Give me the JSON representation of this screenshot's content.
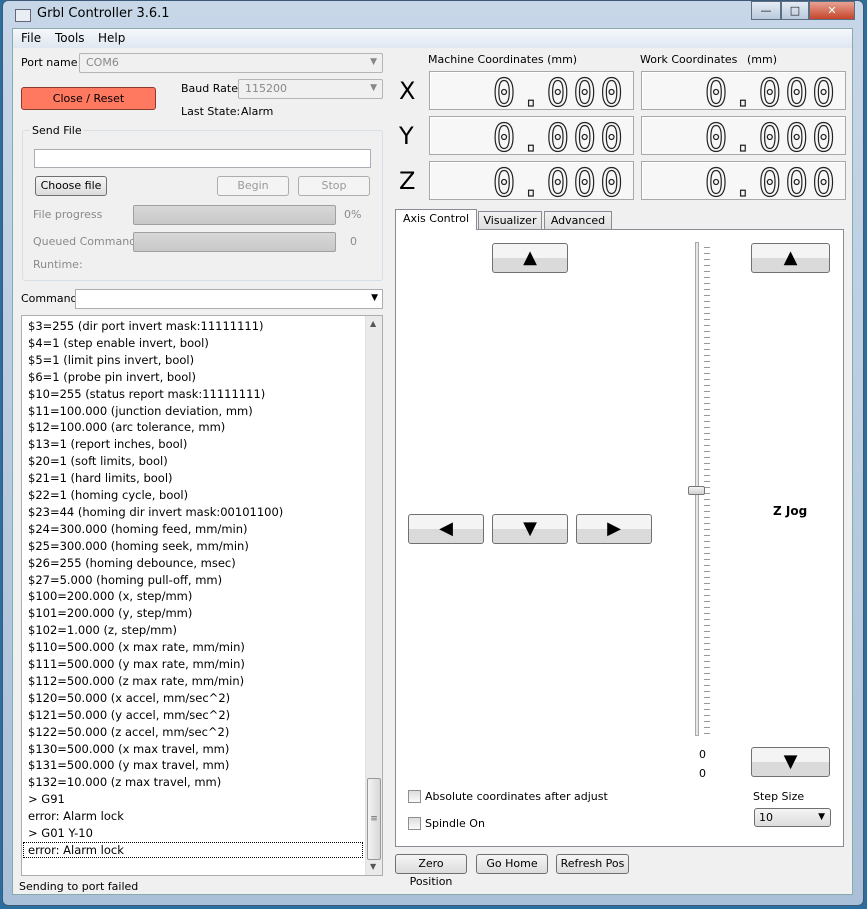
{
  "window": {
    "title": "Grbl Controller 3.6.1",
    "min": "—",
    "max": "□",
    "close": "✕"
  },
  "menu": [
    "File",
    "Tools",
    "Help"
  ],
  "port": {
    "label": "Port name",
    "value": "COM6"
  },
  "baud": {
    "label": "Baud Rate",
    "value": "115200"
  },
  "close_reset": "Close / Reset",
  "last_state": {
    "label": "Last State:",
    "value": "Alarm"
  },
  "send_file": {
    "title": "Send File",
    "file_value": "",
    "choose": "Choose file",
    "begin": "Begin",
    "stop": "Stop",
    "file_progress_label": "File progress",
    "file_progress_value": "0%",
    "file_progress_fraction": 0,
    "queued_label": "Queued Commands",
    "queued_value": "0",
    "runtime_label": "Runtime:"
  },
  "command": {
    "label": "Command",
    "value": ""
  },
  "console": [
    "$3=255 (dir port invert mask:11111111)",
    "$4=1 (step enable invert, bool)",
    "$5=1 (limit pins invert, bool)",
    "$6=1 (probe pin invert, bool)",
    "$10=255 (status report mask:11111111)",
    "$11=100.000 (junction deviation, mm)",
    "$12=100.000 (arc tolerance, mm)",
    "$13=1 (report inches, bool)",
    "$20=1 (soft limits, bool)",
    "$21=1 (hard limits, bool)",
    "$22=1 (homing cycle, bool)",
    "$23=44 (homing dir invert mask:00101100)",
    "$24=300.000 (homing feed, mm/min)",
    "$25=300.000 (homing seek, mm/min)",
    "$26=255 (homing debounce, msec)",
    "$27=5.000 (homing pull-off, mm)",
    "$100=200.000 (x, step/mm)",
    "$101=200.000 (y, step/mm)",
    "$102=1.000 (z, step/mm)",
    "$110=500.000 (x max rate, mm/min)",
    "$111=500.000 (y max rate, mm/min)",
    "$112=500.000 (z max rate, mm/min)",
    "$120=50.000 (x accel, mm/sec^2)",
    "$121=50.000 (y accel, mm/sec^2)",
    "$122=50.000 (z accel, mm/sec^2)",
    "$130=500.000 (x max travel, mm)",
    "$131=500.000 (y max travel, mm)",
    "$132=10.000 (z max travel, mm)",
    "> G91",
    "error: Alarm lock",
    "> G01 Y-10",
    "error: Alarm lock"
  ],
  "status_bar": "Sending to port failed",
  "coords": {
    "machine_label": "Machine Coordinates  (mm)",
    "work_label": "Work Coordinates",
    "work_unit": "(mm)",
    "axes": [
      "X",
      "Y",
      "Z"
    ],
    "machine": [
      "0.000",
      "0.000",
      "0.000"
    ],
    "work": [
      "0.000",
      "0.000",
      "0.000"
    ]
  },
  "tabs": [
    "Axis Control",
    "Visualizer",
    "Advanced"
  ],
  "axis_control": {
    "up": "▲",
    "down": "▼",
    "left": "◀",
    "right": "▶",
    "z_up": "▲",
    "z_down": "▼",
    "z_jog": "Z Jog",
    "slider_value_1": "0",
    "slider_value_2": "0",
    "abs_coords": "Absolute coordinates after adjust",
    "spindle": "Spindle On",
    "step_size_label": "Step Size",
    "step_size": "10"
  },
  "bottom_buttons": {
    "zero": "Zero Position",
    "home": "Go Home",
    "refresh": "Refresh Pos"
  }
}
